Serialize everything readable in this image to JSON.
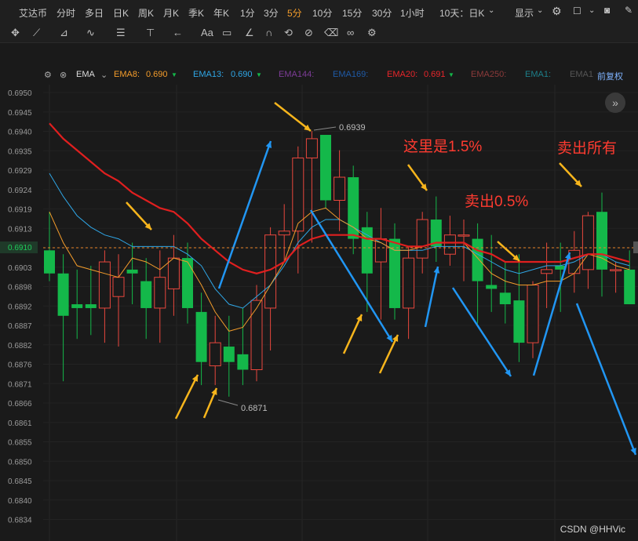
{
  "topbar": {
    "symbol": "艾达币",
    "periods": [
      "分时",
      "多日",
      "日K",
      "周K",
      "月K",
      "季K",
      "年K",
      "1分",
      "3分",
      "5分",
      "10分",
      "15分",
      "30分",
      "1小时",
      "10天：日K"
    ],
    "active_period": "5分",
    "display_label": "显示"
  },
  "toolbar_icons": [
    "crosshair-icon",
    "line-icon",
    "polyline-icon",
    "wave-icon",
    "fib-icon",
    "vertical-tool-icon",
    "arrow-tool-icon",
    "text-tool-icon",
    "comment-icon",
    "ruler-icon",
    "magnet-icon",
    "sync-icon",
    "hide-icon",
    "trash-icon",
    "link-icon",
    "settings-icon"
  ],
  "toolbar_text_tool": "Aa",
  "ema_bar": {
    "label": "EMA",
    "items": [
      {
        "name": "EMA8:",
        "value": "0.690",
        "color": "#f39c2b"
      },
      {
        "name": "EMA13:",
        "value": "0.690",
        "color": "#2fa6e6"
      },
      {
        "name": "EMA144:",
        "value": "",
        "color": "#7d3c98"
      },
      {
        "name": "EMA169:",
        "value": "",
        "color": "#1f5aa6"
      },
      {
        "name": "EMA20:",
        "value": "0.691",
        "color": "#e8262b"
      },
      {
        "name": "EMA250:",
        "value": "",
        "color": "#8c3a3a"
      },
      {
        "name": "EMA1:",
        "value": "",
        "color": "#1d7f8a"
      },
      {
        "name": "EMA1",
        "value": "",
        "color": "#555555"
      }
    ],
    "adjust_label": "前复权"
  },
  "annotations": {
    "note_1": "这里是1.5%",
    "note_2": "卖出0.5%",
    "note_3": "卖出所有",
    "high_label": "0.6939",
    "low_label": "0.6871",
    "current_price": "0.6910"
  },
  "watermark": "CSDN @HHVic",
  "colors": {
    "up": "#e8473d",
    "down": "#14b84a",
    "ema8": "#f39c2b",
    "ema13": "#2fa6e6",
    "ema20": "#e01f1f",
    "note": "#ff3b30",
    "arrow_yellow": "#f7b51c",
    "arrow_blue": "#2196f3"
  },
  "chart_data": {
    "type": "candlestick",
    "ylim": [
      0.6835,
      0.6955
    ],
    "y_ticks": [
      "0.6950",
      "0.6945",
      "0.6940",
      "0.6935",
      "0.6929",
      "0.6924",
      "0.6919",
      "0.6913",
      "0.6908",
      "0.6903",
      "0.6898",
      "0.6892",
      "0.6887",
      "0.6882",
      "0.6876",
      "0.6871",
      "0.6866",
      "0.6861",
      "0.6855",
      "0.6850",
      "0.6845",
      "0.6840",
      "0.6834"
    ],
    "candles": [
      {
        "o": 0.6909,
        "h": 0.6919,
        "l": 0.6901,
        "c": 0.6903
      },
      {
        "o": 0.6903,
        "h": 0.6908,
        "l": 0.6875,
        "c": 0.6892
      },
      {
        "o": 0.6895,
        "h": 0.6904,
        "l": 0.6886,
        "c": 0.6894
      },
      {
        "o": 0.6895,
        "h": 0.6905,
        "l": 0.6887,
        "c": 0.6894
      },
      {
        "o": 0.6894,
        "h": 0.6909,
        "l": 0.6885,
        "c": 0.6906
      },
      {
        "o": 0.6897,
        "h": 0.6908,
        "l": 0.6884,
        "c": 0.6902
      },
      {
        "o": 0.6904,
        "h": 0.6911,
        "l": 0.6895,
        "c": 0.6903
      },
      {
        "o": 0.6901,
        "h": 0.6907,
        "l": 0.6886,
        "c": 0.6894
      },
      {
        "o": 0.6894,
        "h": 0.6909,
        "l": 0.6885,
        "c": 0.6902
      },
      {
        "o": 0.6899,
        "h": 0.6913,
        "l": 0.6892,
        "c": 0.6907
      },
      {
        "o": 0.6907,
        "h": 0.6911,
        "l": 0.689,
        "c": 0.6894
      },
      {
        "o": 0.6893,
        "h": 0.6898,
        "l": 0.6874,
        "c": 0.688
      },
      {
        "o": 0.6879,
        "h": 0.6892,
        "l": 0.6874,
        "c": 0.6885
      },
      {
        "o": 0.6884,
        "h": 0.6892,
        "l": 0.6871,
        "c": 0.688
      },
      {
        "o": 0.6882,
        "h": 0.6894,
        "l": 0.6874,
        "c": 0.6878
      },
      {
        "o": 0.6878,
        "h": 0.69,
        "l": 0.6875,
        "c": 0.6896
      },
      {
        "o": 0.6894,
        "h": 0.6915,
        "l": 0.6883,
        "c": 0.6913
      },
      {
        "o": 0.6913,
        "h": 0.6921,
        "l": 0.6906,
        "c": 0.6914
      },
      {
        "o": 0.6914,
        "h": 0.6936,
        "l": 0.6903,
        "c": 0.6933
      },
      {
        "o": 0.6933,
        "h": 0.694,
        "l": 0.6911,
        "c": 0.6938
      },
      {
        "o": 0.6939,
        "h": 0.6939,
        "l": 0.692,
        "c": 0.6922
      },
      {
        "o": 0.6922,
        "h": 0.6935,
        "l": 0.6914,
        "c": 0.6928
      },
      {
        "o": 0.6928,
        "h": 0.6931,
        "l": 0.6908,
        "c": 0.6912
      },
      {
        "o": 0.6915,
        "h": 0.6919,
        "l": 0.6893,
        "c": 0.6903
      },
      {
        "o": 0.6906,
        "h": 0.692,
        "l": 0.6891,
        "c": 0.6912
      },
      {
        "o": 0.6912,
        "h": 0.6916,
        "l": 0.6891,
        "c": 0.6894
      },
      {
        "o": 0.6894,
        "h": 0.691,
        "l": 0.6886,
        "c": 0.6907
      },
      {
        "o": 0.6907,
        "h": 0.6919,
        "l": 0.6903,
        "c": 0.6917
      },
      {
        "o": 0.6917,
        "h": 0.6923,
        "l": 0.6906,
        "c": 0.691
      },
      {
        "o": 0.6908,
        "h": 0.6918,
        "l": 0.6905,
        "c": 0.6913
      },
      {
        "o": 0.6913,
        "h": 0.6917,
        "l": 0.6901,
        "c": 0.6913
      },
      {
        "o": 0.6912,
        "h": 0.6916,
        "l": 0.689,
        "c": 0.6901
      },
      {
        "o": 0.69,
        "h": 0.6913,
        "l": 0.6893,
        "c": 0.6899
      },
      {
        "o": 0.6898,
        "h": 0.6906,
        "l": 0.689,
        "c": 0.6895
      },
      {
        "o": 0.6896,
        "h": 0.6908,
        "l": 0.688,
        "c": 0.6885
      },
      {
        "o": 0.6885,
        "h": 0.6901,
        "l": 0.6881,
        "c": 0.69
      },
      {
        "o": 0.6903,
        "h": 0.6911,
        "l": 0.6894,
        "c": 0.6904
      },
      {
        "o": 0.6905,
        "h": 0.6911,
        "l": 0.6893,
        "c": 0.6904
      },
      {
        "o": 0.6903,
        "h": 0.6914,
        "l": 0.6898,
        "c": 0.6909
      },
      {
        "o": 0.6904,
        "h": 0.6919,
        "l": 0.6899,
        "c": 0.6918
      },
      {
        "o": 0.6919,
        "h": 0.6924,
        "l": 0.6897,
        "c": 0.6904
      },
      {
        "o": 0.6904,
        "h": 0.6906,
        "l": 0.6898,
        "c": 0.6904
      },
      {
        "o": 0.6904,
        "h": 0.6909,
        "l": 0.6895,
        "c": 0.6895
      }
    ],
    "ema8": [
      0.6919,
      0.6911,
      0.6905,
      0.6904,
      0.6903,
      0.6902,
      0.6907,
      0.6906,
      0.6904,
      0.6907,
      0.6906,
      0.69,
      0.6893,
      0.6888,
      0.6889,
      0.6894,
      0.69,
      0.6906,
      0.6916,
      0.6919,
      0.692,
      0.6917,
      0.6915,
      0.6912,
      0.6911,
      0.6909,
      0.6909,
      0.691,
      0.6911,
      0.6911,
      0.6911,
      0.6907,
      0.6903,
      0.6901,
      0.69,
      0.69,
      0.6901,
      0.6901,
      0.6903,
      0.6908,
      0.6907,
      0.6905,
      0.6904
    ],
    "ema13": [
      0.6929,
      0.6923,
      0.6918,
      0.6915,
      0.6913,
      0.6912,
      0.691,
      0.691,
      0.691,
      0.691,
      0.6908,
      0.6905,
      0.6899,
      0.6895,
      0.6894,
      0.6897,
      0.69,
      0.6905,
      0.6911,
      0.6915,
      0.6917,
      0.6917,
      0.6915,
      0.6913,
      0.6911,
      0.6909,
      0.6909,
      0.6909,
      0.691,
      0.691,
      0.691,
      0.6908,
      0.6906,
      0.6904,
      0.6903,
      0.6904,
      0.6905,
      0.6905,
      0.6906,
      0.6908,
      0.6908,
      0.6906,
      0.6905
    ],
    "ema20": [
      0.6942,
      0.6938,
      0.6935,
      0.6932,
      0.6929,
      0.6927,
      0.6924,
      0.6922,
      0.692,
      0.6919,
      0.6916,
      0.6912,
      0.6909,
      0.6906,
      0.6904,
      0.6903,
      0.6904,
      0.6906,
      0.691,
      0.6912,
      0.6913,
      0.6913,
      0.6913,
      0.6912,
      0.6912,
      0.6911,
      0.691,
      0.691,
      0.6911,
      0.6911,
      0.6911,
      0.6909,
      0.6908,
      0.6906,
      0.6906,
      0.6906,
      0.6906,
      0.6906,
      0.6907,
      0.6908,
      0.6908,
      0.6907,
      0.6906
    ]
  }
}
